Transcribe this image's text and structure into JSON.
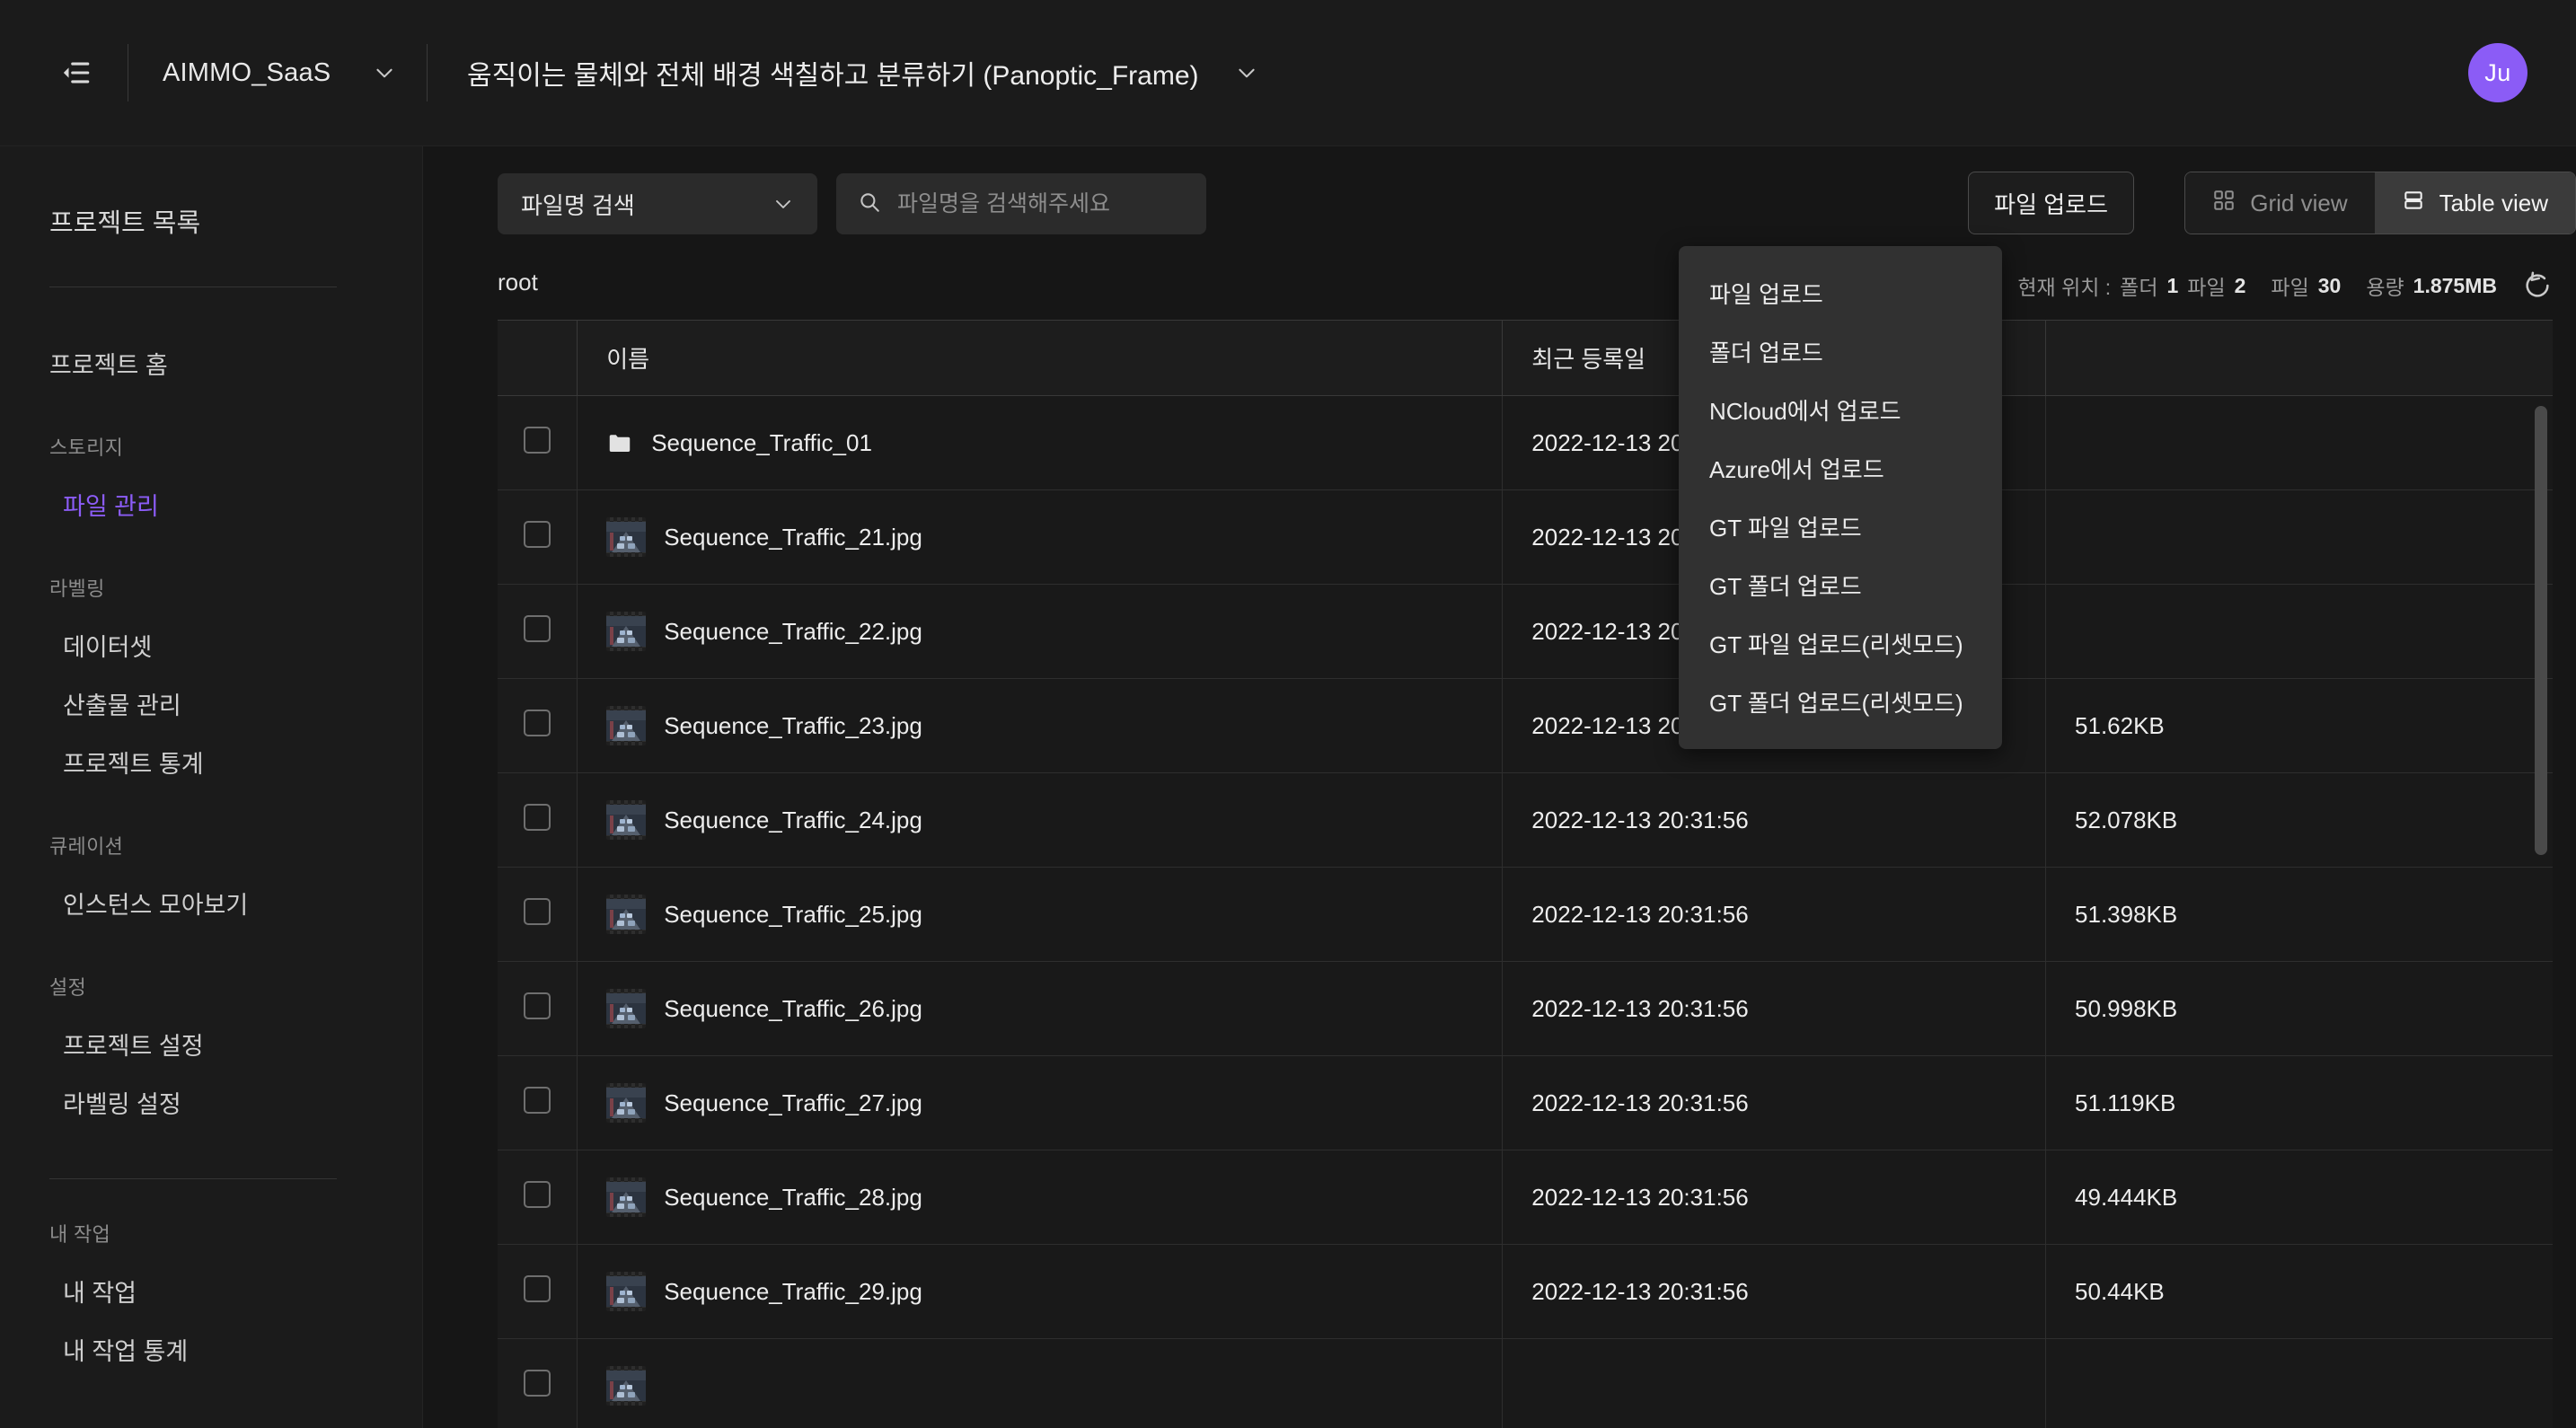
{
  "topbar": {
    "collapse_icon": "collapse-sidebar-icon",
    "project_name": "AIMMO_SaaS",
    "project_chevron": "chevron-down-icon",
    "task_name": "움직이는 물체와 전체 배경 색칠하고 분류하기 (Panoptic_Frame)",
    "task_chevron": "chevron-down-icon",
    "avatar_initials": "Ju",
    "avatar_color": "#8b5cf6"
  },
  "sidebar": {
    "title": "프로젝트 목록",
    "home": "프로젝트 홈",
    "groups": [
      {
        "caption": "스토리지",
        "items": [
          {
            "label": "파일 관리",
            "active": true
          }
        ]
      },
      {
        "caption": "라벨링",
        "items": [
          {
            "label": "데이터셋",
            "active": false
          },
          {
            "label": "산출물 관리",
            "active": false
          },
          {
            "label": "프로젝트 통계",
            "active": false
          }
        ]
      },
      {
        "caption": "큐레이션",
        "items": [
          {
            "label": "인스턴스 모아보기",
            "active": false
          }
        ]
      },
      {
        "caption": "설정",
        "items": [
          {
            "label": "프로젝트 설정",
            "active": false
          },
          {
            "label": "라벨링 설정",
            "active": false
          }
        ]
      }
    ],
    "footer_group": {
      "caption": "내 작업",
      "items": [
        {
          "label": "내 작업",
          "active": false
        },
        {
          "label": "내 작업 통계",
          "active": false
        }
      ]
    }
  },
  "toolbar": {
    "filter_label": "파일명 검색",
    "filter_chevron": "chevron-down-icon",
    "search_icon": "search-icon",
    "search_value": "",
    "search_placeholder": "파일명을 검색해주세요",
    "upload_button": "파일 업로드",
    "grid_view": "Grid view",
    "grid_view_icon": "grid-icon",
    "table_view": "Table view",
    "table_view_icon": "table-icon",
    "active_view": "Table view"
  },
  "upload_menu": {
    "open": true,
    "items": [
      "파일 업로드",
      "폴더 업로드",
      "NCloud에서 업로드",
      "Azure에서 업로드",
      "GT 파일 업로드",
      "GT 폴더 업로드",
      "GT 파일 업로드(리셋모드)",
      "GT 폴더 업로드(리셋모드)"
    ]
  },
  "status": {
    "breadcrumb": "root",
    "location_label": "현재 위치 :",
    "location_folder_label": "폴더",
    "location_folder_count": "1",
    "location_file_label": "파일",
    "location_file_count": "2",
    "total_file_label": "파일",
    "total_file_count": "30",
    "total_size_label": "용량",
    "total_size_value": "1.875MB",
    "refresh_icon": "refresh-icon"
  },
  "table": {
    "columns": [
      "",
      "이름",
      "최근 등록일",
      ""
    ],
    "rows": [
      {
        "type": "folder",
        "name": "Sequence_Traffic_01",
        "date": "2022-12-13 20:31:38",
        "size": ""
      },
      {
        "type": "image",
        "name": "Sequence_Traffic_21.jpg",
        "date": "2022-12-13 20:31:56",
        "size": ""
      },
      {
        "type": "image",
        "name": "Sequence_Traffic_22.jpg",
        "date": "2022-12-13 20:31:56",
        "size": ""
      },
      {
        "type": "image",
        "name": "Sequence_Traffic_23.jpg",
        "date": "2022-12-13 20:31:56",
        "size": "51.62KB"
      },
      {
        "type": "image",
        "name": "Sequence_Traffic_24.jpg",
        "date": "2022-12-13 20:31:56",
        "size": "52.078KB"
      },
      {
        "type": "image",
        "name": "Sequence_Traffic_25.jpg",
        "date": "2022-12-13 20:31:56",
        "size": "51.398KB"
      },
      {
        "type": "image",
        "name": "Sequence_Traffic_26.jpg",
        "date": "2022-12-13 20:31:56",
        "size": "50.998KB"
      },
      {
        "type": "image",
        "name": "Sequence_Traffic_27.jpg",
        "date": "2022-12-13 20:31:56",
        "size": "51.119KB"
      },
      {
        "type": "image",
        "name": "Sequence_Traffic_28.jpg",
        "date": "2022-12-13 20:31:56",
        "size": "49.444KB"
      },
      {
        "type": "image",
        "name": "Sequence_Traffic_29.jpg",
        "date": "2022-12-13 20:31:56",
        "size": "50.44KB"
      },
      {
        "type": "image",
        "name": "",
        "date": "",
        "size": ""
      }
    ]
  }
}
